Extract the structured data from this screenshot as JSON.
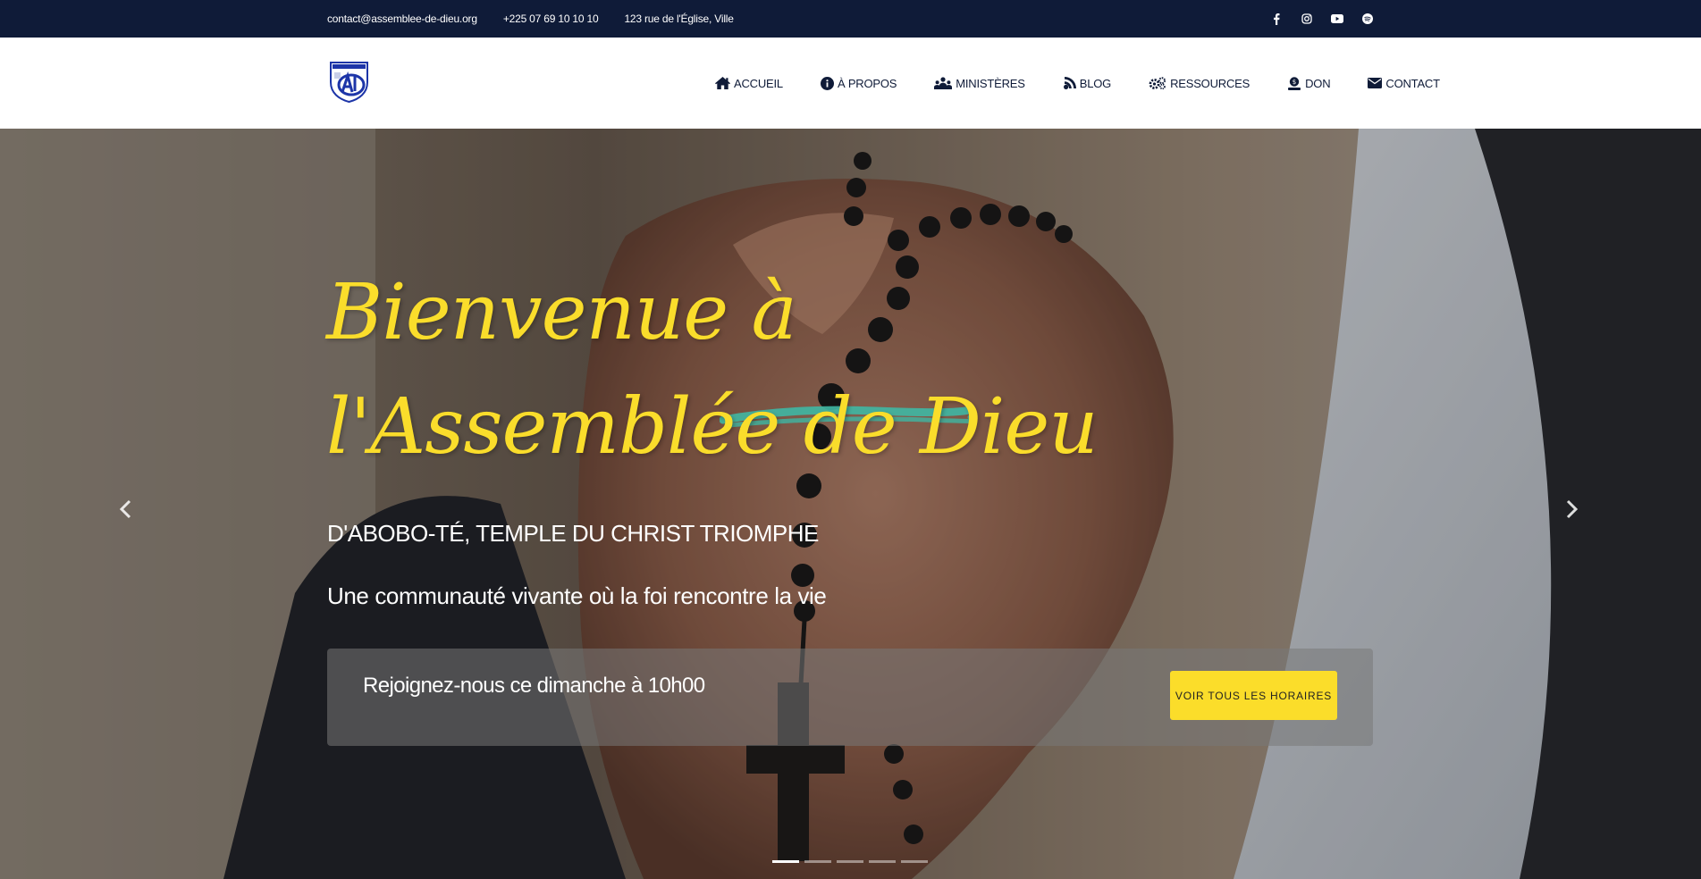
{
  "topbar": {
    "email": "contact@assemblee-de-dieu.org",
    "phone": "+225 07 69 10 10 10",
    "address": "123 rue de l'Église, Ville",
    "socials": [
      "facebook-icon",
      "instagram-icon",
      "youtube-icon",
      "spotify-icon"
    ]
  },
  "brand": {
    "logo_icon": "church-logo"
  },
  "nav": {
    "items": [
      {
        "label": "ACCUEIL",
        "icon": "home-icon"
      },
      {
        "label": "À PROPOS",
        "icon": "info-circle-icon"
      },
      {
        "label": "MINISTÈRES",
        "icon": "people-group-icon"
      },
      {
        "label": "BLOG",
        "icon": "blog-icon"
      },
      {
        "label": "RESSOURCES",
        "icon": "gears-icon"
      },
      {
        "label": "DON",
        "icon": "donate-icon"
      },
      {
        "label": "CONTACT",
        "icon": "envelope-icon"
      }
    ]
  },
  "hero": {
    "title_line1": "Bienvenue à",
    "title_line2": "l'Assemblée de Dieu",
    "subtitle": "D'ABOBO-TÉ, TEMPLE DU CHRIST TRIOMPHE",
    "tagline": "Une communauté vivante où la foi rencontre la vie",
    "schedule_message": "Rejoignez-nous ce dimanche à 10h00",
    "schedule_button": "VOIR TOUS LES HORAIRES",
    "slides_count": 5,
    "active_slide": 1
  },
  "colors": {
    "topbar_bg": "#0f1b38",
    "accent_yellow": "#fbdd2a",
    "accent_teal": "#3fb7a3",
    "nav_text": "#0f1b38"
  }
}
